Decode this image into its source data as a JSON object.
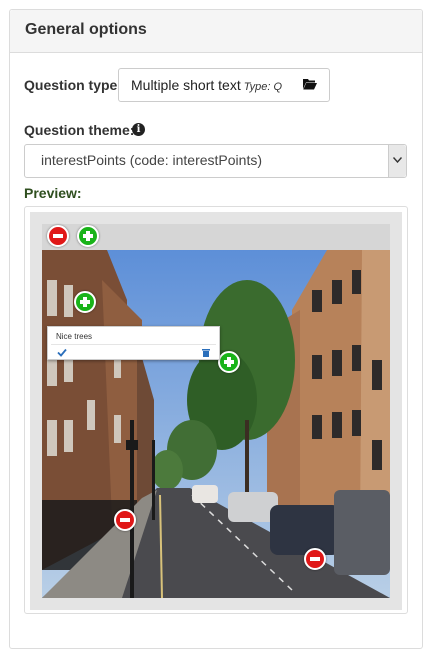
{
  "panel": {
    "title": "General options"
  },
  "question_type": {
    "label": "Question type:",
    "value": "Multiple short text",
    "type_tag": "Type: Q",
    "button_icon": "folder-open-icon"
  },
  "question_theme": {
    "label": "Question theme:",
    "info_icon": "info-circle-icon",
    "selected": "interestPoints (code: interestPoints)"
  },
  "preview": {
    "label": "Preview:",
    "popup_text": "Nice trees",
    "colors": {
      "add": "#19b319",
      "remove": "#e01818"
    }
  }
}
